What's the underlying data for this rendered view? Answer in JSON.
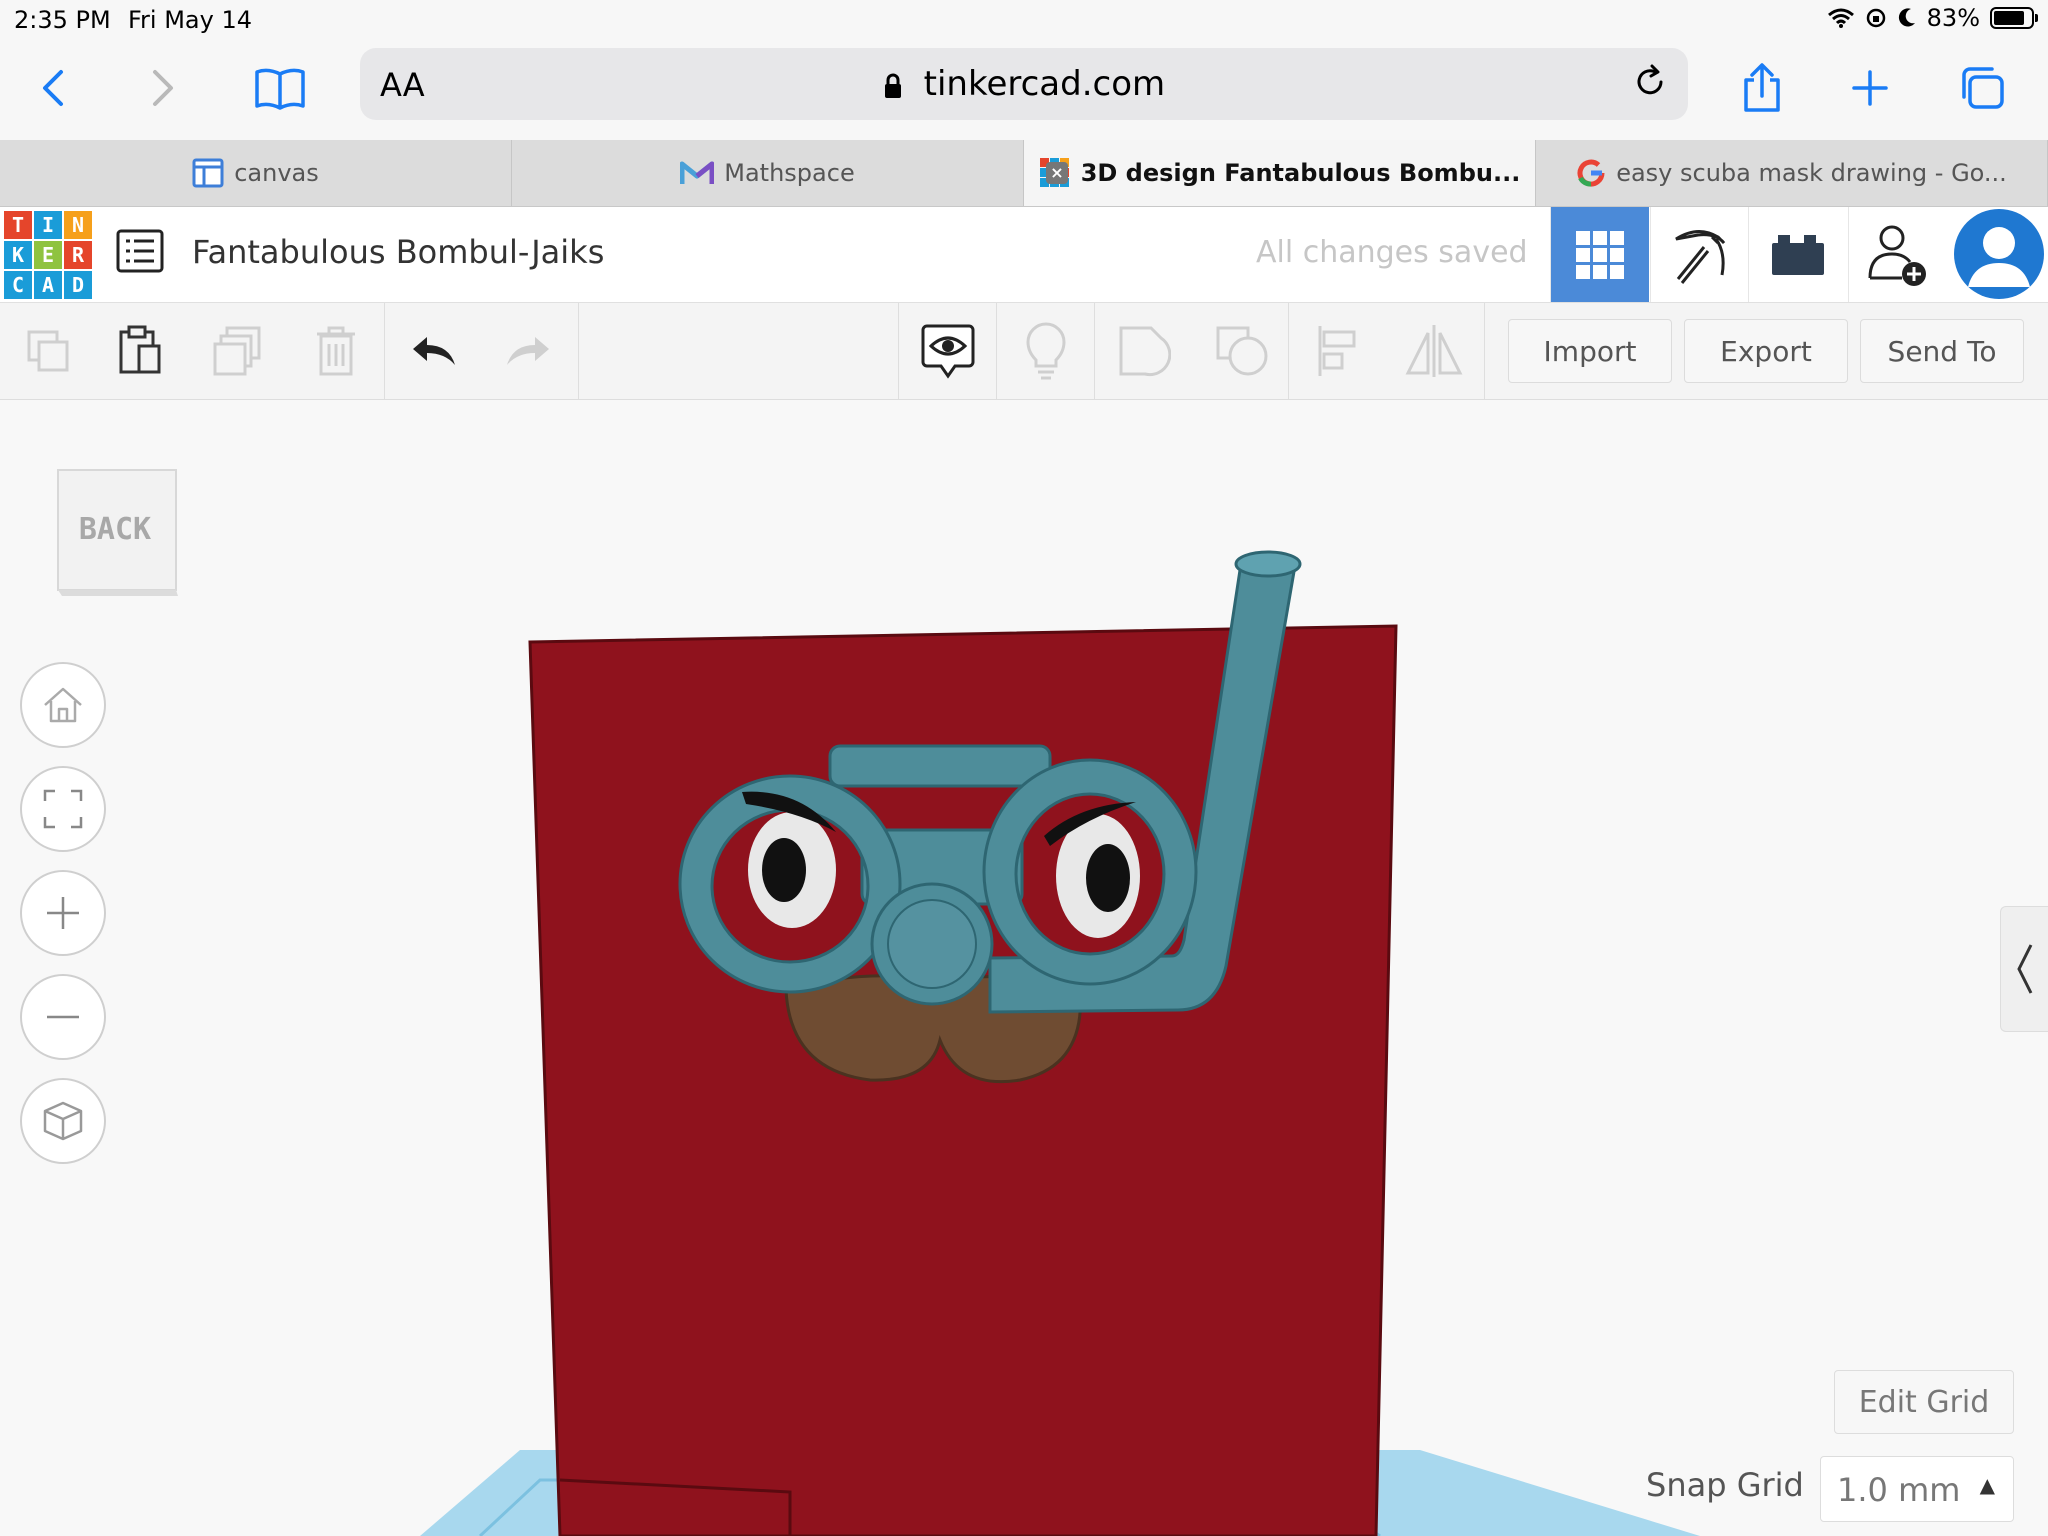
{
  "status_bar": {
    "time": "2:35 PM",
    "date": "Fri May 14",
    "battery": "83%",
    "battery_level": 0.83
  },
  "browser": {
    "text_size_label": "AA",
    "url": "tinkercad.com",
    "tabs": [
      {
        "label": "canvas",
        "active": false
      },
      {
        "label": "Mathspace",
        "active": false
      },
      {
        "label": "3D design Fantabulous Bombu...",
        "active": true
      },
      {
        "label": "easy scuba mask drawing - Go...",
        "active": false
      }
    ]
  },
  "tinkercad": {
    "logo_letters": [
      "T",
      "I",
      "N",
      "K",
      "E",
      "R",
      "C",
      "A",
      "D"
    ],
    "logo_colors": [
      "#e5452b",
      "#1a9cd8",
      "#f6a01a",
      "#1a9cd8",
      "#8fc340",
      "#e5452b",
      "#1a9cd8",
      "#1a9cd8",
      "#1a9cd8"
    ],
    "design_title": "Fantabulous Bombul-Jaiks",
    "save_status": "All changes saved",
    "toolbar": {
      "import_label": "Import",
      "export_label": "Export",
      "send_to_label": "Send To"
    },
    "view_cube_label": "BACK",
    "edit_grid_label": "Edit Grid",
    "snap_grid_label": "Snap Grid",
    "snap_grid_value": "1.0 mm"
  },
  "colors": {
    "accent_blue": "#4b8ad8",
    "model_red": "#8f121d",
    "mask_teal": "#4e8d9a",
    "mustache_brown": "#6f4c32",
    "workplane_blue": "#a8d8ee"
  }
}
